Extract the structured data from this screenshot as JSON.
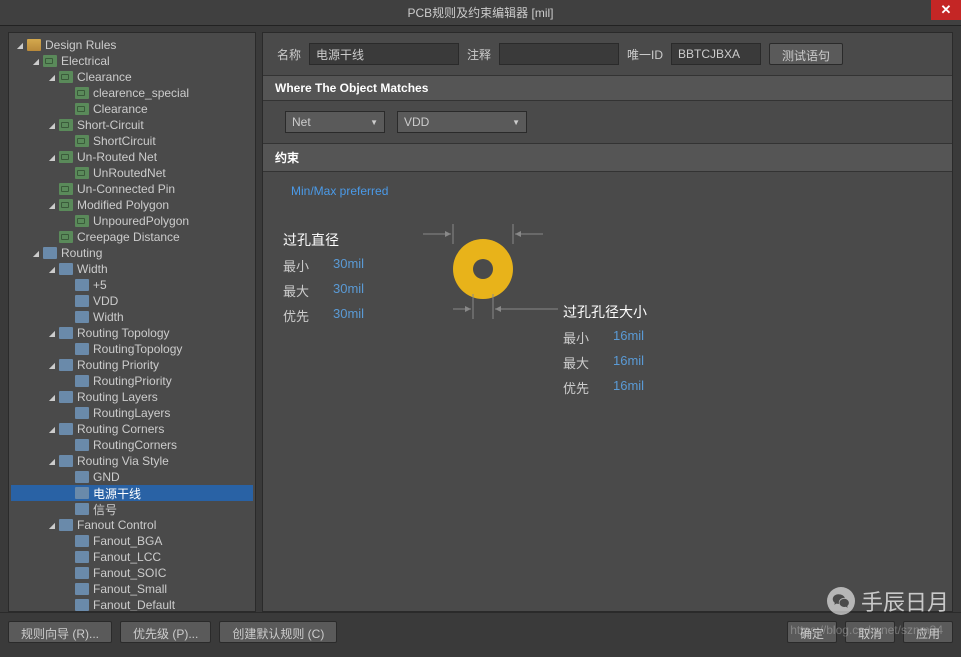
{
  "window": {
    "title": "PCB规则及约束编辑器 [mil]"
  },
  "tree": {
    "root": "Design Rules",
    "electrical": {
      "label": "Electrical",
      "clearance": {
        "label": "Clearance",
        "items": [
          "clearence_special",
          "Clearance"
        ]
      },
      "shortcircuit": {
        "label": "Short-Circuit",
        "items": [
          "ShortCircuit"
        ]
      },
      "unrouted": {
        "label": "Un-Routed Net",
        "items": [
          "UnRoutedNet"
        ]
      },
      "unconnected": "Un-Connected Pin",
      "modpoly": {
        "label": "Modified Polygon",
        "items": [
          "UnpouredPolygon"
        ]
      },
      "creepage": "Creepage Distance"
    },
    "routing": {
      "label": "Routing",
      "width": {
        "label": "Width",
        "items": [
          "+5",
          "VDD",
          "Width"
        ]
      },
      "topology": {
        "label": "Routing Topology",
        "items": [
          "RoutingTopology"
        ]
      },
      "priority": {
        "label": "Routing Priority",
        "items": [
          "RoutingPriority"
        ]
      },
      "layers": {
        "label": "Routing Layers",
        "items": [
          "RoutingLayers"
        ]
      },
      "corners": {
        "label": "Routing Corners",
        "items": [
          "RoutingCorners"
        ]
      },
      "viastyle": {
        "label": "Routing Via Style",
        "items": [
          "GND",
          "电源干线",
          "信号"
        ]
      },
      "fanout": {
        "label": "Fanout Control",
        "items": [
          "Fanout_BGA",
          "Fanout_LCC",
          "Fanout_SOIC",
          "Fanout_Small",
          "Fanout_Default"
        ]
      }
    }
  },
  "fields": {
    "name_label": "名称",
    "name_value": "电源干线",
    "comment_label": "注释",
    "comment_value": "",
    "uid_label": "唯一ID",
    "uid_value": "BBTCJBXA",
    "test_btn": "测试语句"
  },
  "match": {
    "header": "Where The Object Matches",
    "scope": "Net",
    "net": "VDD"
  },
  "constraint": {
    "header": "约束",
    "minmax_link": "Min/Max preferred",
    "via_dia": {
      "title": "过孔直径",
      "min_label": "最小",
      "min_value": "30mil",
      "max_label": "最大",
      "max_value": "30mil",
      "pref_label": "优先",
      "pref_value": "30mil"
    },
    "hole_dia": {
      "title": "过孔孔径大小",
      "min_label": "最小",
      "min_value": "16mil",
      "max_label": "最大",
      "max_value": "16mil",
      "pref_label": "优先",
      "pref_value": "16mil"
    }
  },
  "buttons": {
    "wizard": "规则向导 (R)...",
    "priority": "优先级 (P)...",
    "create_default": "创建默认规则 (C)",
    "ok": "确定",
    "cancel": "取消",
    "apply": "应用"
  },
  "watermark": {
    "text": "手辰日月",
    "url": "https://blog.csdn.net/sznm34"
  }
}
